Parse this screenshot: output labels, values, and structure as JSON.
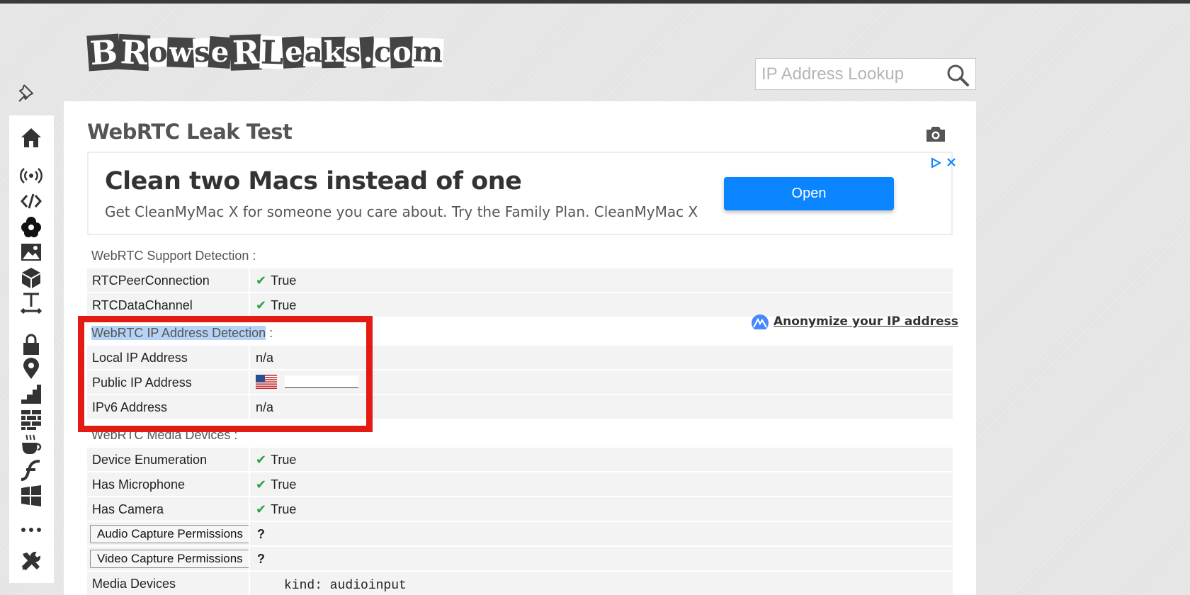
{
  "logo": {
    "text": "BrowserLeaks.com"
  },
  "search": {
    "placeholder": "IP Address Lookup"
  },
  "sidebar": {
    "icons": [
      "home-icon",
      "broadcast-icon",
      "code-icon",
      "flower-icon",
      "image-icon",
      "cube-icon",
      "text-size-icon",
      "lock-icon",
      "location-pin-icon",
      "stairs-icon",
      "bricks-icon",
      "java-cup-icon",
      "flash-icon",
      "windows-icon",
      "more-icon",
      "tools-icon"
    ]
  },
  "page": {
    "title": "WebRTC Leak Test"
  },
  "ad": {
    "title": "Clean two Macs instead of one",
    "text": "Get CleanMyMac X for someone you care about. Try the Family Plan. CleanMyMac X",
    "button": "Open"
  },
  "support": {
    "heading": "WebRTC Support Detection :",
    "rows": [
      {
        "label": "RTCPeerConnection",
        "value": "True"
      },
      {
        "label": "RTCDataChannel",
        "value": "True"
      }
    ]
  },
  "ip": {
    "heading": "WebRTC IP Address Detection",
    "heading_suffix": " :",
    "anonymize": "Anonymize your IP address",
    "rows": [
      {
        "label": "Local IP Address",
        "value": "n/a"
      },
      {
        "label": "Public IP Address",
        "value": ""
      },
      {
        "label": "IPv6 Address",
        "value": "n/a"
      }
    ]
  },
  "media": {
    "heading": "WebRTC Media Devices :",
    "rows": [
      {
        "label": "Device Enumeration",
        "value": "True"
      },
      {
        "label": "Has Microphone",
        "value": "True"
      },
      {
        "label": "Has Camera",
        "value": "True"
      }
    ],
    "audio_button": "Audio Capture Permissions",
    "video_button": "Video Capture Permissions",
    "permission_status": "?",
    "devices_label": "Media Devices",
    "devices_value": "kind: audioinput"
  },
  "colors": {
    "highlight_box": "#e41b13",
    "check": "#2ea043",
    "ad_button": "#0a84ff"
  }
}
